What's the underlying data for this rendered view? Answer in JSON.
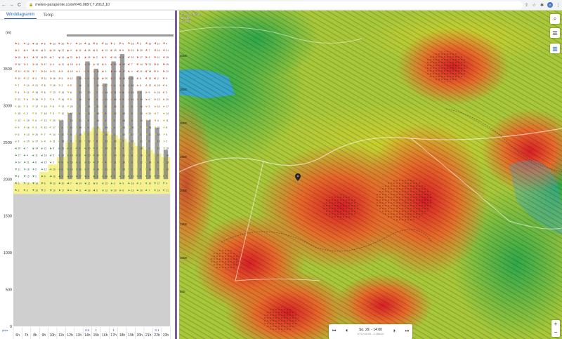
{
  "browser": {
    "url": "meteo-parapente.com/#/46.0897,7.2012,10",
    "nav_back": "←",
    "nav_forward": "→",
    "nav_reload": "C",
    "lock": "🔒",
    "icons": [
      "share-icon",
      "star-icon",
      "extensions-icon",
      "profile-avatar",
      "menu-icon"
    ],
    "avatar_letter": "G"
  },
  "panel": {
    "tabs": [
      {
        "label": "Winddiagramm",
        "active": true
      },
      {
        "label": "Temp",
        "active": false
      }
    ],
    "unit": "(m)",
    "altitude_labels": [
      "3500",
      "3000",
      "2500",
      "2000",
      "1500",
      "1000",
      "500",
      "0"
    ],
    "hours": [
      "6h",
      "7h",
      "8h",
      "9h",
      "10h",
      "11h",
      "12h",
      "13h",
      "14h",
      "15h",
      "16h",
      "17h",
      "18h",
      "19h",
      "20h",
      "21h",
      "22h",
      "23h"
    ],
    "precip": [
      "",
      "",
      "",
      "",
      "",
      "",
      "",
      "",
      "0.4",
      "1",
      "",
      "1",
      "",
      "",
      "",
      "",
      "0.1",
      ""
    ],
    "precip_unit": "pluie"
  },
  "map": {
    "legend": "Grenzschicht\nDecke\nm MSL",
    "side_scale": [
      "4000",
      "3500",
      "3000",
      "2500",
      "2000",
      "1500",
      "1000",
      "500"
    ],
    "controls": [
      {
        "icon": "search-icon",
        "glyph": "⌕"
      },
      {
        "icon": "sliders-icon",
        "glyph": "☰"
      },
      {
        "icon": "chart-icon",
        "glyph": "▥"
      }
    ],
    "time": {
      "label": "So. 29. - 14:00",
      "sub": "UTC+02:00 - 2.25h/10",
      "first": "⏮",
      "prev": "⏴",
      "next": "⏵",
      "last": "⏭"
    },
    "zoom_in": "+",
    "zoom_out": "−"
  }
}
